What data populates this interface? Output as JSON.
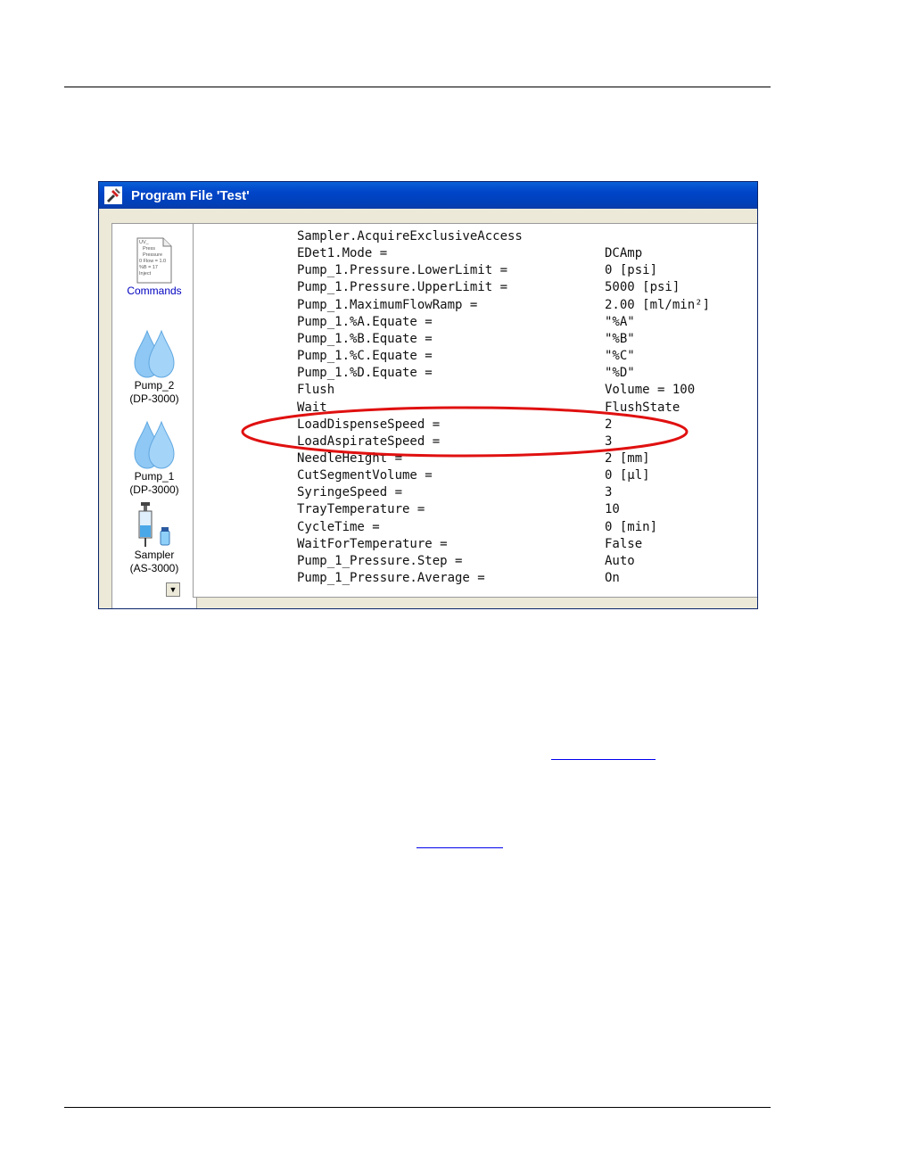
{
  "window": {
    "title": "Program File 'Test'"
  },
  "devices": [
    {
      "name": "Commands",
      "model": ""
    },
    {
      "name": "Pump_2",
      "model": "(DP-3000)"
    },
    {
      "name": "Pump_1",
      "model": "(DP-3000)"
    },
    {
      "name": "Sampler",
      "model": "(AS-3000)"
    }
  ],
  "commands_icon_text": [
    "UV_",
    "Press",
    "Pressure",
    "0 Flow = 1.0",
    "%B = 17",
    "Inject"
  ],
  "program_lines": [
    {
      "cmd": "Sampler.AcquireExclusiveAccess",
      "val": ""
    },
    {
      "cmd": "EDet1.Mode =",
      "val": "DCAmp"
    },
    {
      "cmd": "Pump_1.Pressure.LowerLimit =",
      "val": "0 [psi]"
    },
    {
      "cmd": "Pump_1.Pressure.UpperLimit =",
      "val": "5000 [psi]"
    },
    {
      "cmd": "Pump_1.MaximumFlowRamp =",
      "val": "2.00 [ml/min²]"
    },
    {
      "cmd": "Pump_1.%A.Equate =",
      "val": "\"%A\""
    },
    {
      "cmd": "Pump_1.%B.Equate =",
      "val": "\"%B\""
    },
    {
      "cmd": "Pump_1.%C.Equate =",
      "val": "\"%C\""
    },
    {
      "cmd": "Pump_1.%D.Equate =",
      "val": "\"%D\""
    },
    {
      "cmd": "Flush",
      "val": "Volume = 100"
    },
    {
      "cmd": "Wait",
      "val": "FlushState"
    },
    {
      "cmd": "LoadDispenseSpeed =",
      "val": "2"
    },
    {
      "cmd": "LoadAspirateSpeed =",
      "val": "3"
    },
    {
      "cmd": "NeedleHeight =",
      "val": "2 [mm]"
    },
    {
      "cmd": "CutSegmentVolume =",
      "val": "0 [µl]"
    },
    {
      "cmd": "SyringeSpeed =",
      "val": "3"
    },
    {
      "cmd": "TrayTemperature =",
      "val": "10"
    },
    {
      "cmd": "CycleTime =",
      "val": "0 [min]"
    },
    {
      "cmd": "WaitForTemperature =",
      "val": "False"
    },
    {
      "cmd": "Pump_1_Pressure.Step =",
      "val": "Auto"
    },
    {
      "cmd": "Pump_1_Pressure.Average =",
      "val": "On"
    }
  ],
  "colors": {
    "highlight": "#e01010",
    "titlebar": "#0044c8",
    "drop": "#8fc8f4"
  }
}
